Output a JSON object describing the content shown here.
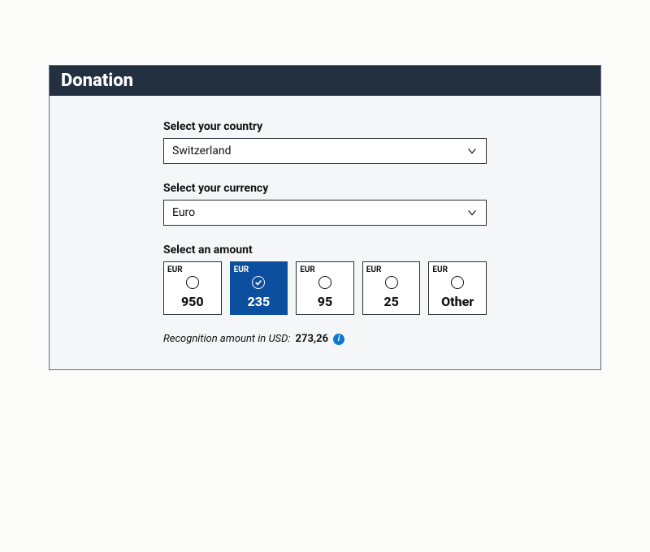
{
  "header": {
    "title": "Donation"
  },
  "country": {
    "label": "Select your country",
    "value": "Switzerland"
  },
  "currency": {
    "label": "Select your currency",
    "value": "Euro"
  },
  "amount": {
    "label": "Select an amount",
    "currency_code": "EUR",
    "options": [
      {
        "value": "950",
        "selected": false
      },
      {
        "value": "235",
        "selected": true
      },
      {
        "value": "95",
        "selected": false
      },
      {
        "value": "25",
        "selected": false
      },
      {
        "value": "Other",
        "selected": false
      }
    ]
  },
  "recognition": {
    "prefix": "Recognition amount in USD:",
    "value": "273,26"
  }
}
